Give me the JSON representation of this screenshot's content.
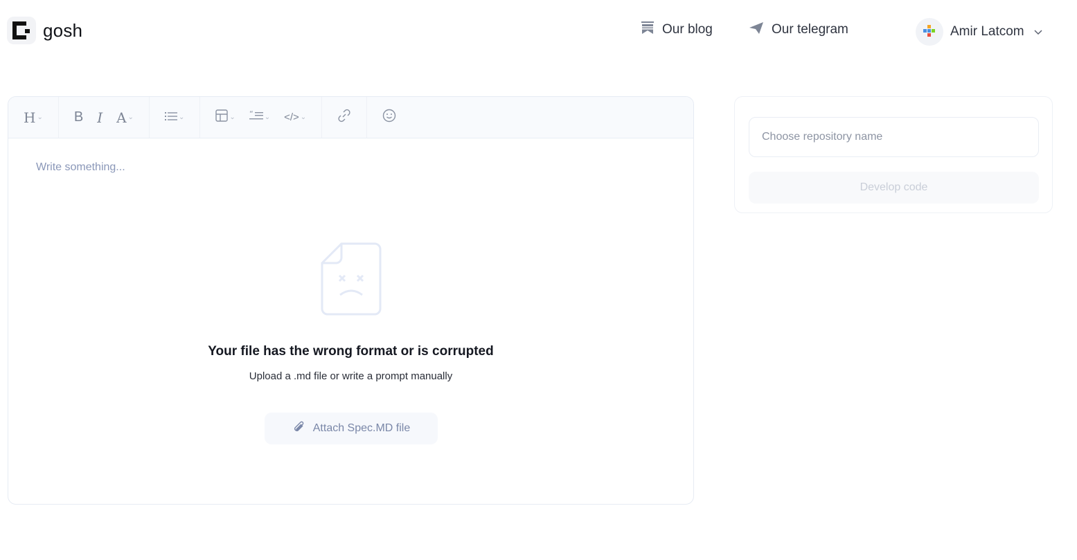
{
  "header": {
    "logo_text": "gosh",
    "nav": [
      {
        "label": "Our blog",
        "icon": "bookmark-icon"
      },
      {
        "label": "Our telegram",
        "icon": "telegram-icon"
      }
    ],
    "user_name": "Amir Latcom"
  },
  "toolbar": {
    "items": [
      "heading-icon",
      "bold-icon",
      "italic-icon",
      "text-style-icon",
      "list-icon",
      "table-icon",
      "quote-icon",
      "code-icon",
      "link-icon",
      "emoji-icon"
    ],
    "labels": {
      "heading": "H",
      "bold": "B",
      "italic": "I",
      "text_style": "A",
      "code": "</>"
    }
  },
  "editor": {
    "placeholder": "Write something...",
    "error_title": "Your file has the wrong format or is corrupted",
    "error_subtitle": "Upload a .md file or write a prompt manually",
    "attach_label": "Attach Spec.MD file"
  },
  "side": {
    "repo_placeholder": "Choose repository name",
    "repo_value": "",
    "develop_label": "Develop code"
  },
  "colors": {
    "accent_muted": "#7a87a8",
    "border": "#e6ebf3",
    "toolbar_bg": "#f8fafd"
  }
}
